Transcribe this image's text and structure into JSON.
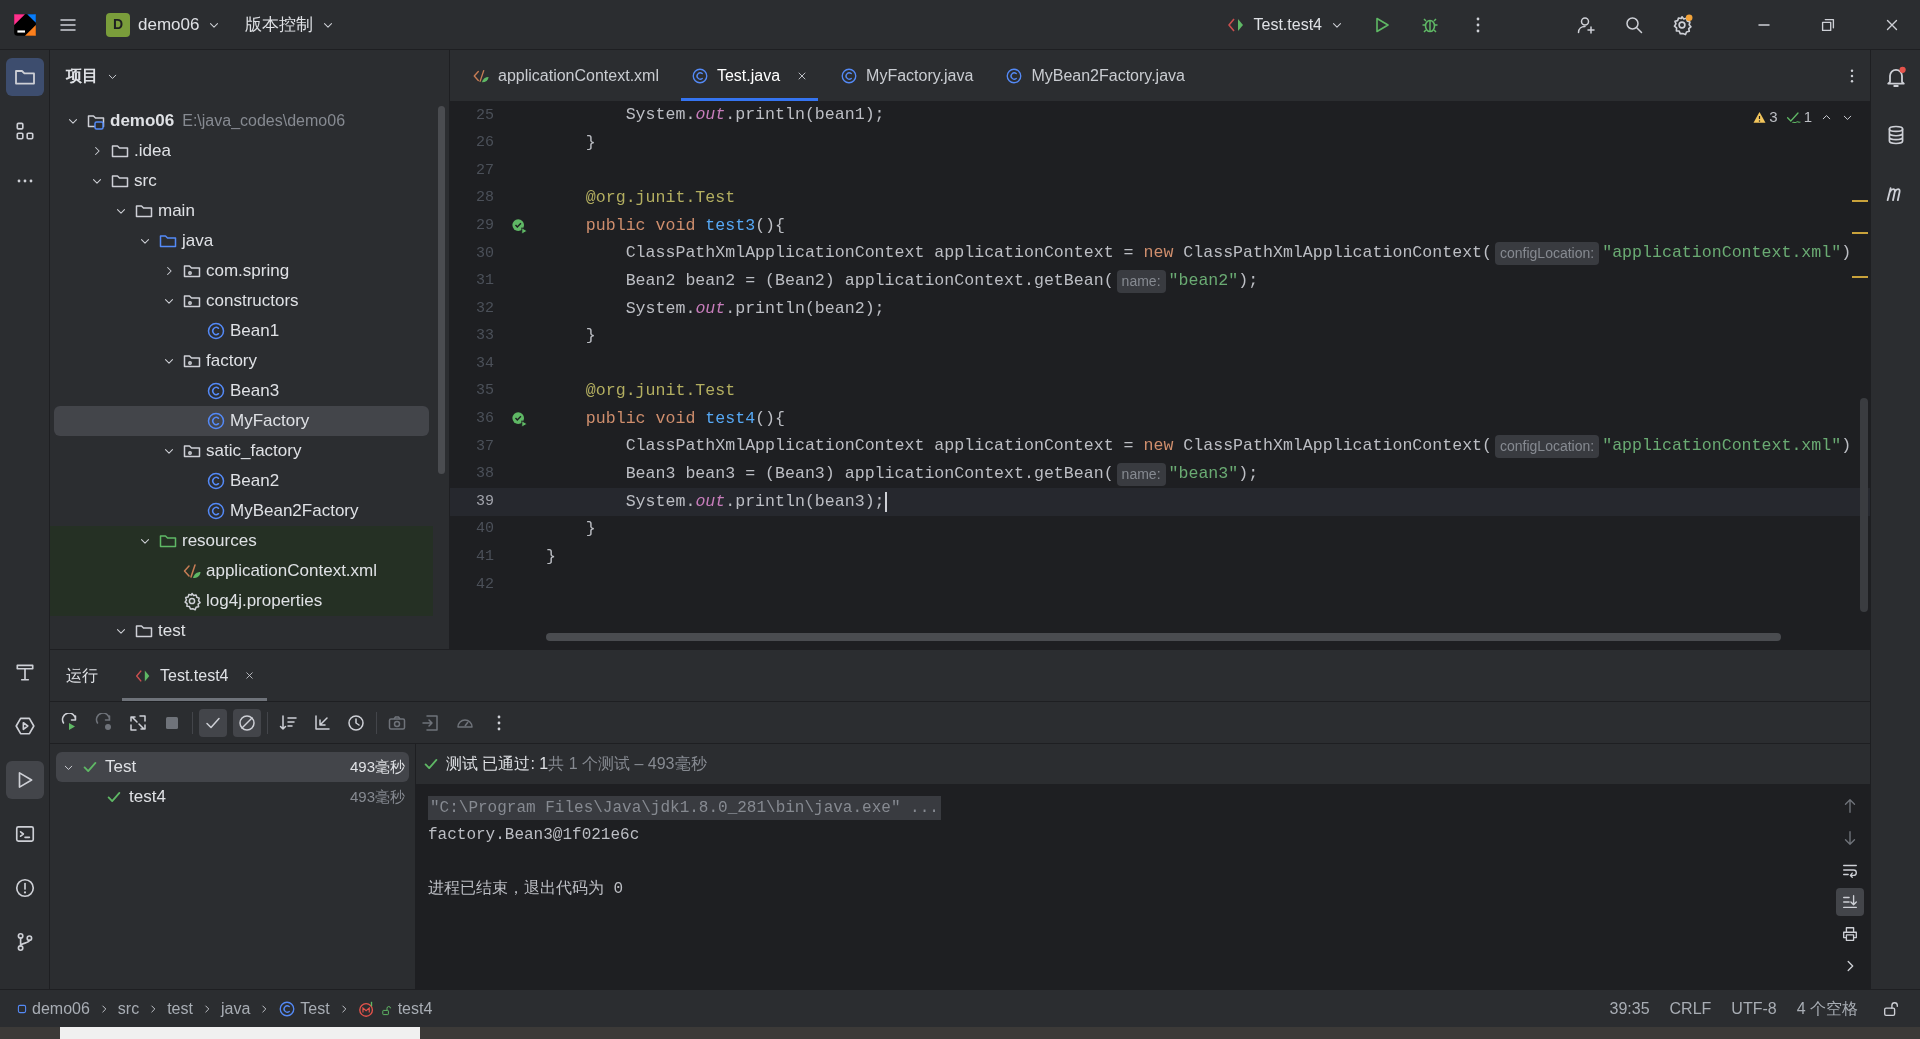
{
  "title_bar": {
    "project": "demo06",
    "project_badge": "D",
    "vcs": "版本控制",
    "run_config": "Test.test4"
  },
  "project_panel": {
    "title": "项目",
    "tree": [
      {
        "label": "demo06",
        "path": "E:\\java_codes\\demo06",
        "kind": "module",
        "expanded": true,
        "selected": false,
        "children": [
          {
            "label": ".idea",
            "kind": "folder",
            "expanded": false,
            "selected": false
          },
          {
            "label": "src",
            "kind": "folder",
            "expanded": true,
            "selected": false,
            "children": [
              {
                "label": "main",
                "kind": "folder",
                "expanded": true,
                "selected": false,
                "children": [
                  {
                    "label": "java",
                    "kind": "source",
                    "expanded": true,
                    "selected": false,
                    "children": [
                      {
                        "label": "com.spring",
                        "kind": "package",
                        "expanded": false,
                        "selected": false
                      },
                      {
                        "label": "constructors",
                        "kind": "package",
                        "expanded": true,
                        "selected": false,
                        "children": [
                          {
                            "label": "Bean1",
                            "kind": "class",
                            "selected": false
                          }
                        ]
                      },
                      {
                        "label": "factory",
                        "kind": "package",
                        "expanded": true,
                        "selected": false,
                        "children": [
                          {
                            "label": "Bean3",
                            "kind": "class",
                            "selected": false
                          },
                          {
                            "label": "MyFactory",
                            "kind": "class",
                            "selected": true
                          }
                        ]
                      },
                      {
                        "label": "satic_factory",
                        "kind": "package",
                        "expanded": true,
                        "selected": false,
                        "children": [
                          {
                            "label": "Bean2",
                            "kind": "class",
                            "selected": false
                          },
                          {
                            "label": "MyBean2Factory",
                            "kind": "class",
                            "selected": false
                          }
                        ]
                      }
                    ]
                  },
                  {
                    "label": "resources",
                    "kind": "resources",
                    "expanded": true,
                    "selected": false,
                    "children": [
                      {
                        "label": "applicationContext.xml",
                        "kind": "xml",
                        "selected": false
                      },
                      {
                        "label": "log4j.properties",
                        "kind": "properties",
                        "selected": false
                      }
                    ]
                  }
                ]
              },
              {
                "label": "test",
                "kind": "folder",
                "expanded": true,
                "selected": false
              }
            ]
          }
        ]
      }
    ]
  },
  "editor_tabs": [
    {
      "label": "applicationContext.xml",
      "kind": "xml",
      "selected": false
    },
    {
      "label": "Test.java",
      "kind": "class",
      "selected": true
    },
    {
      "label": "MyFactory.java",
      "kind": "class",
      "selected": false
    },
    {
      "label": "MyBean2Factory.java",
      "kind": "class",
      "selected": false
    }
  ],
  "inspections": {
    "warnings": "3",
    "weak_warnings": "1"
  },
  "editor": {
    "lines": [
      {
        "number": "25",
        "current": false,
        "run_marker": false,
        "code": [
          {
            "kind": "plain",
            "text": "        System."
          },
          {
            "kind": "field",
            "text": "out"
          },
          {
            "kind": "plain",
            "text": ".println(bean1);"
          }
        ]
      },
      {
        "number": "26",
        "current": false,
        "run_marker": false,
        "code": [
          {
            "kind": "plain",
            "text": "    }"
          }
        ]
      },
      {
        "number": "27",
        "current": false,
        "run_marker": false
      },
      {
        "number": "28",
        "current": false,
        "run_marker": false,
        "code": [
          {
            "kind": "annotation",
            "text": "    @org.junit.Test"
          }
        ]
      },
      {
        "number": "29",
        "current": false,
        "run_marker": true,
        "code": [
          {
            "kind": "keyword",
            "text": "    public void "
          },
          {
            "kind": "method",
            "text": "test3"
          },
          {
            "kind": "plain",
            "text": "(){"
          }
        ]
      },
      {
        "number": "30",
        "current": false,
        "run_marker": false,
        "code": [
          {
            "kind": "plain",
            "text": "        ClassPathXmlApplicationContext applicationContext = "
          },
          {
            "kind": "keyword",
            "text": "new"
          },
          {
            "kind": "plain",
            "text": " ClassPathXmlApplicationContext("
          },
          {
            "kind": "hint",
            "text": "configLocation:"
          },
          {
            "kind": "string",
            "text": "\"applicationContext.xml\""
          },
          {
            "kind": "plain",
            "text": ")"
          }
        ]
      },
      {
        "number": "31",
        "current": false,
        "run_marker": false,
        "code": [
          {
            "kind": "plain",
            "text": "        Bean2 bean2 = (Bean2) applicationContext.getBean("
          },
          {
            "kind": "hint",
            "text": "name:"
          },
          {
            "kind": "string",
            "text": "\"bean2\""
          },
          {
            "kind": "plain",
            "text": ");"
          }
        ]
      },
      {
        "number": "32",
        "current": false,
        "run_marker": false,
        "code": [
          {
            "kind": "plain",
            "text": "        System."
          },
          {
            "kind": "field",
            "text": "out"
          },
          {
            "kind": "plain",
            "text": ".println(bean2);"
          }
        ]
      },
      {
        "number": "33",
        "current": false,
        "run_marker": false,
        "code": [
          {
            "kind": "plain",
            "text": "    }"
          }
        ]
      },
      {
        "number": "34",
        "current": false,
        "run_marker": false
      },
      {
        "number": "35",
        "current": false,
        "run_marker": false,
        "code": [
          {
            "kind": "annotation",
            "text": "    @org.junit.Test"
          }
        ]
      },
      {
        "number": "36",
        "current": false,
        "run_marker": true,
        "code": [
          {
            "kind": "keyword",
            "text": "    public void "
          },
          {
            "kind": "method",
            "text": "test4"
          },
          {
            "kind": "plain",
            "text": "(){"
          }
        ]
      },
      {
        "number": "37",
        "current": false,
        "run_marker": false,
        "code": [
          {
            "kind": "plain",
            "text": "        ClassPathXmlApplicationContext applicationContext = "
          },
          {
            "kind": "keyword",
            "text": "new"
          },
          {
            "kind": "plain",
            "text": " ClassPathXmlApplicationContext("
          },
          {
            "kind": "hint",
            "text": "configLocation:"
          },
          {
            "kind": "string",
            "text": "\"applicationContext.xml\""
          },
          {
            "kind": "plain",
            "text": ")"
          }
        ]
      },
      {
        "number": "38",
        "current": false,
        "run_marker": false,
        "code": [
          {
            "kind": "plain",
            "text": "        Bean3 bean3 = (Bean3) applicationContext.getBean("
          },
          {
            "kind": "hint",
            "text": "name:"
          },
          {
            "kind": "string",
            "text": "\"bean3\""
          },
          {
            "kind": "plain",
            "text": ");"
          }
        ]
      },
      {
        "number": "39",
        "current": true,
        "run_marker": false,
        "code": [
          {
            "kind": "plain",
            "text": "        System."
          },
          {
            "kind": "field",
            "text": "out"
          },
          {
            "kind": "plain",
            "text": ".println(bean3);"
          }
        ]
      },
      {
        "number": "40",
        "current": false,
        "run_marker": false,
        "code": [
          {
            "kind": "plain",
            "text": "    }"
          }
        ]
      },
      {
        "number": "41",
        "current": false,
        "run_marker": false,
        "code": [
          {
            "kind": "plain",
            "text": "}"
          }
        ]
      },
      {
        "number": "42",
        "current": false,
        "run_marker": false
      }
    ]
  },
  "run_panel": {
    "title": "运行",
    "tabs": [
      {
        "label": "Test.test4",
        "selected": true
      }
    ],
    "tests": [
      {
        "label": "Test",
        "time": "493毫秒",
        "expanded": true,
        "selected": true,
        "children": [
          {
            "label": "test4",
            "time": "493毫秒",
            "selected": false
          }
        ]
      }
    ],
    "result": {
      "passed": "测试 已通过: 1",
      "summary": "共 1 个测试 – 493毫秒"
    },
    "console": [
      {
        "kind": "command",
        "text": "\"C:\\Program Files\\Java\\jdk1.8.0_281\\bin\\java.exe\" ..."
      },
      {
        "kind": "output",
        "text": "factory.Bean3@1f021e6c"
      },
      {
        "kind": "blank"
      },
      {
        "kind": "output",
        "text": "进程已结束，退出代码为 0"
      }
    ]
  },
  "status_bar": {
    "breadcrumbs": [
      {
        "label": "demo06",
        "kind": "module"
      },
      {
        "label": "src",
        "kind": "folder"
      },
      {
        "label": "test",
        "kind": "folder"
      },
      {
        "label": "java",
        "kind": "folder"
      },
      {
        "label": "Test",
        "kind": "class"
      },
      {
        "label": "test4",
        "kind": "method"
      }
    ],
    "position": "39:35",
    "line_ending": "CRLF",
    "encoding": "UTF-8",
    "indent": "4 个空格"
  }
}
